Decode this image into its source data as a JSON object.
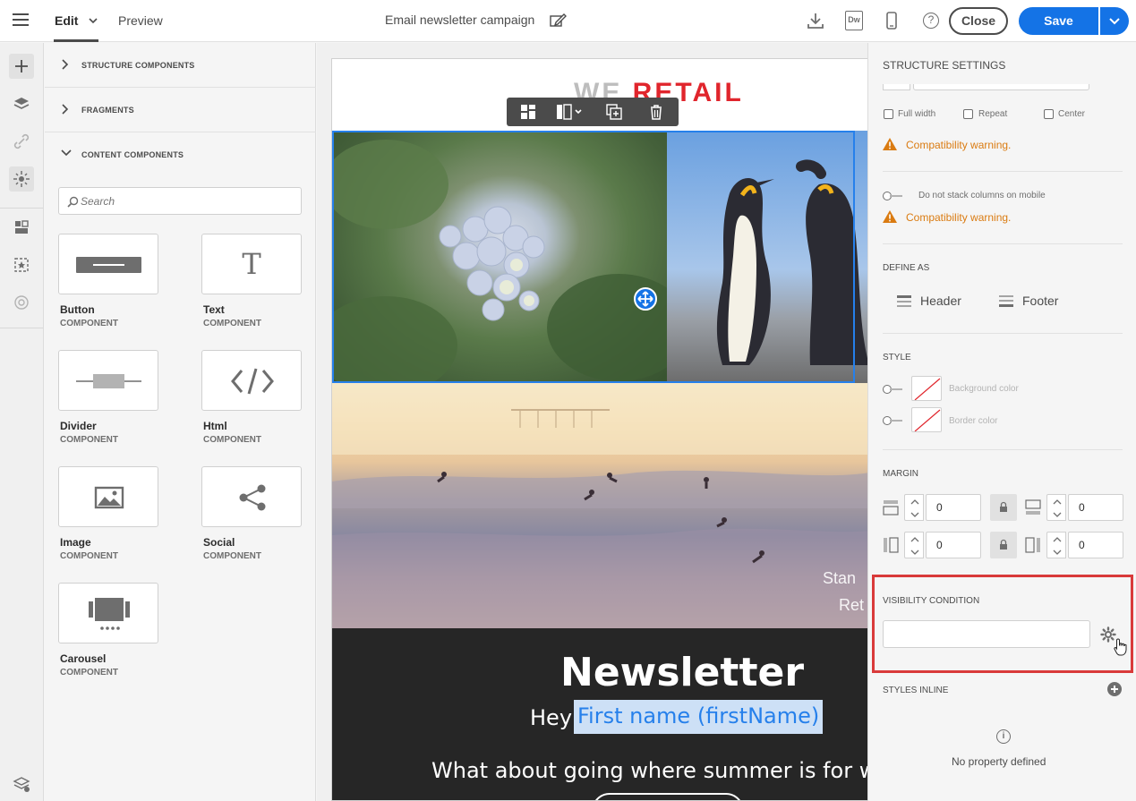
{
  "topbar": {
    "tabs": [
      {
        "label": "Edit"
      },
      {
        "label": "Preview"
      }
    ],
    "doc_title": "Email newsletter campaign",
    "dw_label": "Dw",
    "help_label": "?",
    "close_label": "Close",
    "save_label": "Save"
  },
  "components_panel": {
    "sections": [
      {
        "label": "STRUCTURE COMPONENTS"
      },
      {
        "label": "FRAGMENTS"
      },
      {
        "label": "CONTENT COMPONENTS"
      }
    ],
    "search_placeholder": "Search",
    "items": [
      {
        "name": "Button",
        "type": "COMPONENT",
        "icon": "button-icon"
      },
      {
        "name": "Text",
        "type": "COMPONENT",
        "icon": "text-icon"
      },
      {
        "name": "Divider",
        "type": "COMPONENT",
        "icon": "divider-icon"
      },
      {
        "name": "Html",
        "type": "COMPONENT",
        "icon": "html-icon"
      },
      {
        "name": "Image",
        "type": "COMPONENT",
        "icon": "image-icon"
      },
      {
        "name": "Social",
        "type": "COMPONENT",
        "icon": "share-icon"
      },
      {
        "name": "Carousel",
        "type": "COMPONENT",
        "icon": "carousel-icon"
      }
    ],
    "text_glyph": "T"
  },
  "email": {
    "brand_we": "WE",
    "brand_retail": "RETAIL",
    "beach_caption_1": "Stan",
    "beach_caption_2": "Ret",
    "newsletter_title": "Newsletter",
    "hey": "Hey",
    "first_name": "First name (firstName)",
    "body": "What about going where summer is for wint"
  },
  "settings": {
    "title": "STRUCTURE SETTINGS",
    "checks": [
      "Full width",
      "Repeat",
      "Center"
    ],
    "warning": "Compatibility warning.",
    "stack_label": "Do not stack columns on mobile",
    "define_as": "DEFINE AS",
    "header": "Header",
    "footer": "Footer",
    "style": "STYLE",
    "background_color": "Background color",
    "border_color": "Border color",
    "margin": "MARGIN",
    "margins": {
      "top": "0",
      "bottom": "0",
      "left": "0",
      "right": "0"
    },
    "visibility_condition": "VISIBILITY CONDITION",
    "styles_inline": "STYLES INLINE",
    "info_glyph": "i",
    "no_property": "No property defined"
  },
  "colors": {
    "accent": "#1473e6",
    "warning": "#da7b11",
    "highlight_border": "#d93a3a",
    "brand_red": "#e0252c"
  }
}
